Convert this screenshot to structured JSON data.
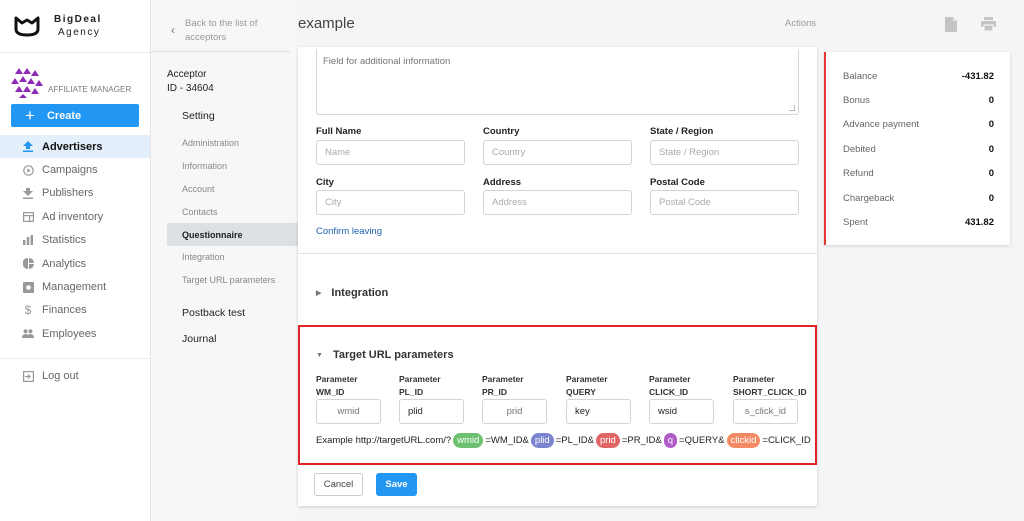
{
  "brand": {
    "line1": "BigDeal",
    "line2": "Agency",
    "role": "AFFILIATE MANAGER",
    "create_label": "Create"
  },
  "nav": {
    "items": [
      {
        "label": "Advertisers",
        "icon": "upload-icon",
        "active": true
      },
      {
        "label": "Campaigns",
        "icon": "play-circle-icon"
      },
      {
        "label": "Publishers",
        "icon": "download-icon"
      },
      {
        "label": "Ad inventory",
        "icon": "inventory-icon"
      },
      {
        "label": "Statistics",
        "icon": "bar-chart-icon"
      },
      {
        "label": "Analytics",
        "icon": "pie-chart-icon"
      },
      {
        "label": "Management",
        "icon": "settings-box-icon"
      },
      {
        "label": "Finances",
        "icon": "dollar-icon"
      },
      {
        "label": "Employees",
        "icon": "people-icon"
      }
    ],
    "logout": "Log out"
  },
  "subnav": {
    "back": "Back to the list of acceptors",
    "acceptor_label": "Acceptor",
    "acceptor_id": "ID - 34604",
    "setting": "Setting",
    "items": [
      "Administration",
      "Information",
      "Account",
      "Contacts",
      "Questionnaire",
      "Integration",
      "Target URL parameters"
    ],
    "active_item": "Questionnaire",
    "postback": "Postback test",
    "journal": "Journal"
  },
  "header": {
    "title": "example",
    "actions": "Actions"
  },
  "form": {
    "additional_placeholder": "Field for additional information",
    "fields": [
      {
        "label": "Full Name",
        "placeholder": "Name"
      },
      {
        "label": "Country",
        "placeholder": "Country"
      },
      {
        "label": "State / Region",
        "placeholder": "State / Region"
      },
      {
        "label": "City",
        "placeholder": "City"
      },
      {
        "label": "Address",
        "placeholder": "Address"
      },
      {
        "label": "Postal Code",
        "placeholder": "Postal Code"
      }
    ],
    "confirm_leaving": "Confirm leaving"
  },
  "integration": {
    "title": "Integration"
  },
  "target_url": {
    "title": "Target URL parameters",
    "params": [
      {
        "label1": "Parameter",
        "label2": "WM_ID",
        "value": "",
        "placeholder": "wmid"
      },
      {
        "label1": "Parameter",
        "label2": "PL_ID",
        "value": "plid",
        "placeholder": ""
      },
      {
        "label1": "Parameter",
        "label2": "PR_ID",
        "value": "",
        "placeholder": "prid"
      },
      {
        "label1": "Parameter",
        "label2": "QUERY",
        "value": "key",
        "placeholder": ""
      },
      {
        "label1": "Parameter",
        "label2": "CLICK_ID",
        "value": "wsid",
        "placeholder": ""
      },
      {
        "label1": "Parameter",
        "label2": "SHORT_CLICK_ID",
        "value": "",
        "placeholder": "s_click_id"
      }
    ],
    "example": {
      "prefix": "Example http://targetURL.com/?",
      "parts": [
        {
          "chip": "wmid",
          "color": "#6cc070",
          "text": "=WM_ID&"
        },
        {
          "chip": "plid",
          "color": "#7b84cf",
          "text": "=PL_ID&"
        },
        {
          "chip": "prid",
          "color": "#e06666",
          "text": "=PR_ID&"
        },
        {
          "chip": "q",
          "color": "#b05cc8",
          "text": "=QUERY&"
        },
        {
          "chip": "clickid",
          "color": "#f48a63",
          "text": "=CLICK_ID"
        }
      ]
    }
  },
  "buttons": {
    "cancel": "Cancel",
    "save": "Save"
  },
  "stats": [
    {
      "label": "Balance",
      "value": "-431.82"
    },
    {
      "label": "Bonus",
      "value": "0"
    },
    {
      "label": "Advance payment",
      "value": "0"
    },
    {
      "label": "Debited",
      "value": "0"
    },
    {
      "label": "Refund",
      "value": "0"
    },
    {
      "label": "Chargeback",
      "value": "0"
    },
    {
      "label": "Spent",
      "value": "431.82"
    }
  ],
  "colors": {
    "accent": "#2196f3",
    "highlight_border": "#e32128",
    "stats_border": "#e53935",
    "link": "#1f5fb0"
  }
}
